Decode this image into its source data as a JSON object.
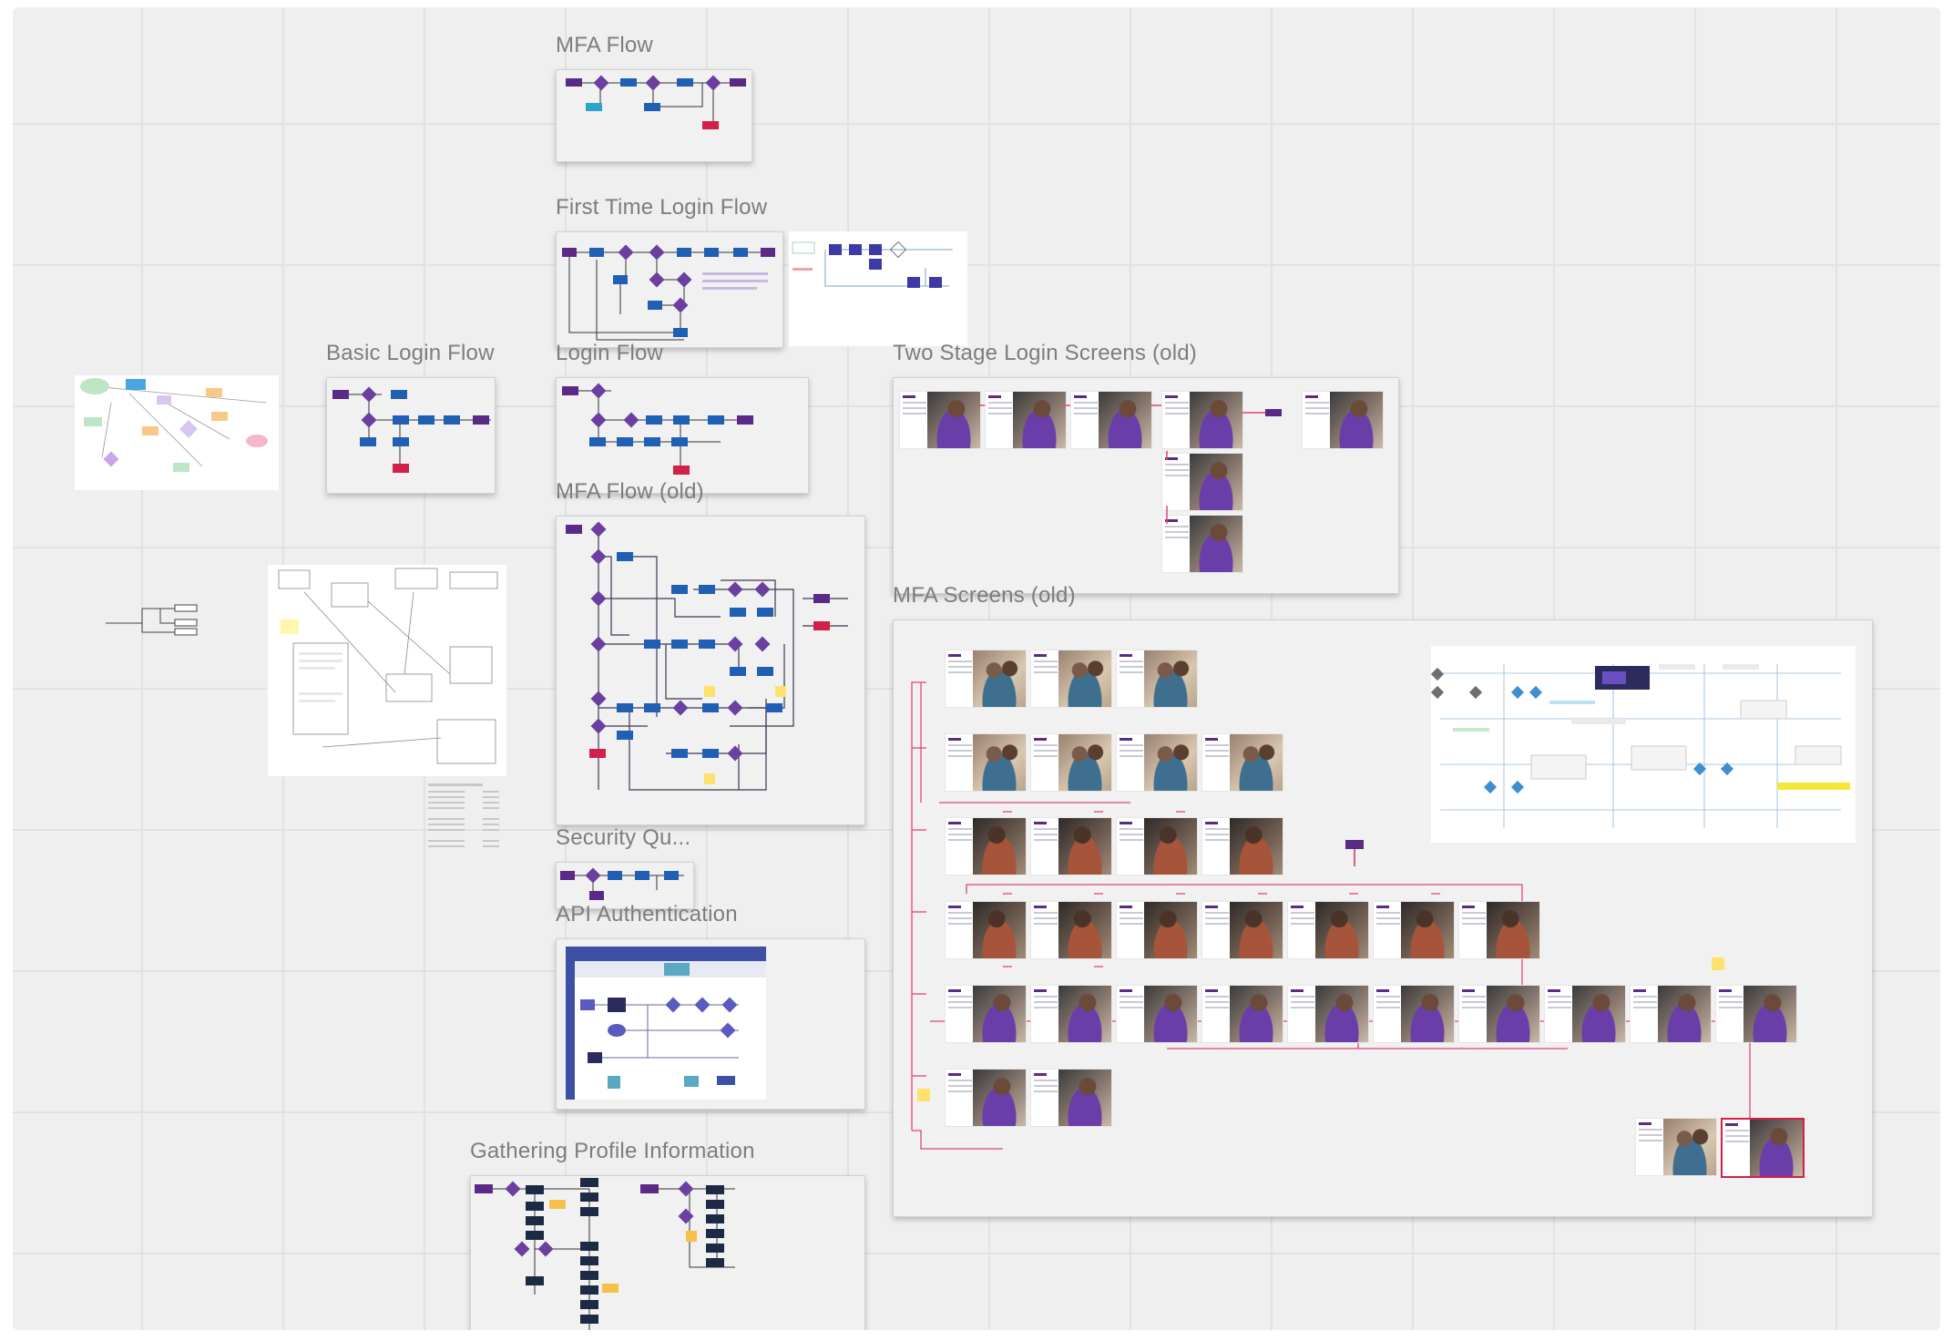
{
  "frames": {
    "mfa_flow": "MFA Flow",
    "first_time_login_flow": "First Time Login Flow",
    "basic_login_flow": "Basic Login Flow",
    "login_flow": "Login Flow",
    "two_stage_login_screens_old": "Two Stage Login Screens (old)",
    "mfa_flow_old": "MFA Flow (old)",
    "mfa_screens_old": "MFA Screens (old)",
    "security_questions": "Security Qu...",
    "api_authentication": "API Authentication",
    "gathering_profile_information": "Gathering Profile Information"
  },
  "colors": {
    "canvas": "#efefef",
    "grid": "#e2e2e2",
    "frame_label": "#7d7d7d",
    "flow_purple": "#5b2a86",
    "flow_blue": "#1f5fb4",
    "flow_red": "#d2204a",
    "flow_navy": "#1d2a44",
    "connector_pink": "#e0467a",
    "sticky_yellow": "#ffe26b"
  },
  "icons": [
    "flow-diagram-icon",
    "screen-thumbnail-icon",
    "sticky-note-icon"
  ]
}
